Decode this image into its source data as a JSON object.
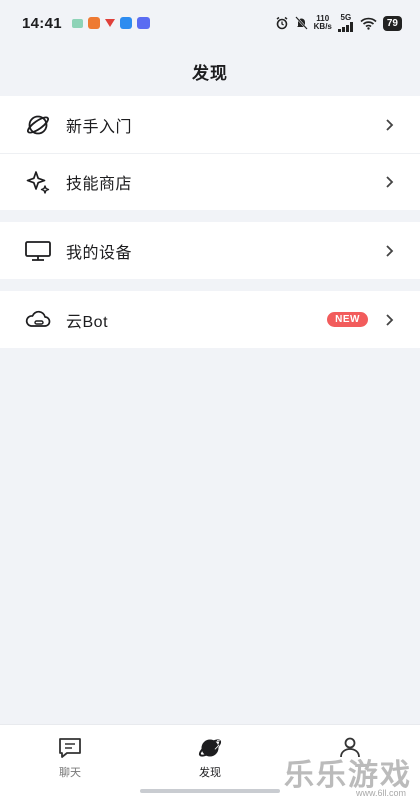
{
  "status_bar": {
    "time": "14:41",
    "speed_top": "110",
    "speed_bottom": "KB/s",
    "network": "5G",
    "battery": "79"
  },
  "header": {
    "title": "发现"
  },
  "groups": [
    {
      "items": [
        {
          "label": "新手入门",
          "icon": "planet-icon"
        },
        {
          "label": "技能商店",
          "icon": "sparkle-icon"
        }
      ]
    },
    {
      "items": [
        {
          "label": "我的设备",
          "icon": "monitor-icon"
        }
      ]
    },
    {
      "items": [
        {
          "label": "云Bot",
          "icon": "cloud-icon",
          "badge": "NEW"
        }
      ]
    }
  ],
  "tabbar": {
    "tabs": [
      {
        "label": "聊天",
        "icon": "chat-icon",
        "active": false
      },
      {
        "label": "发现",
        "icon": "planet-icon",
        "active": true
      },
      {
        "label": "",
        "icon": "profile-icon",
        "active": false
      }
    ]
  },
  "watermark": {
    "text": "乐乐游戏",
    "url": "www.6ll.com"
  },
  "colors": {
    "accent_badge": "#f25c5c",
    "background": "#f1f3f7"
  }
}
